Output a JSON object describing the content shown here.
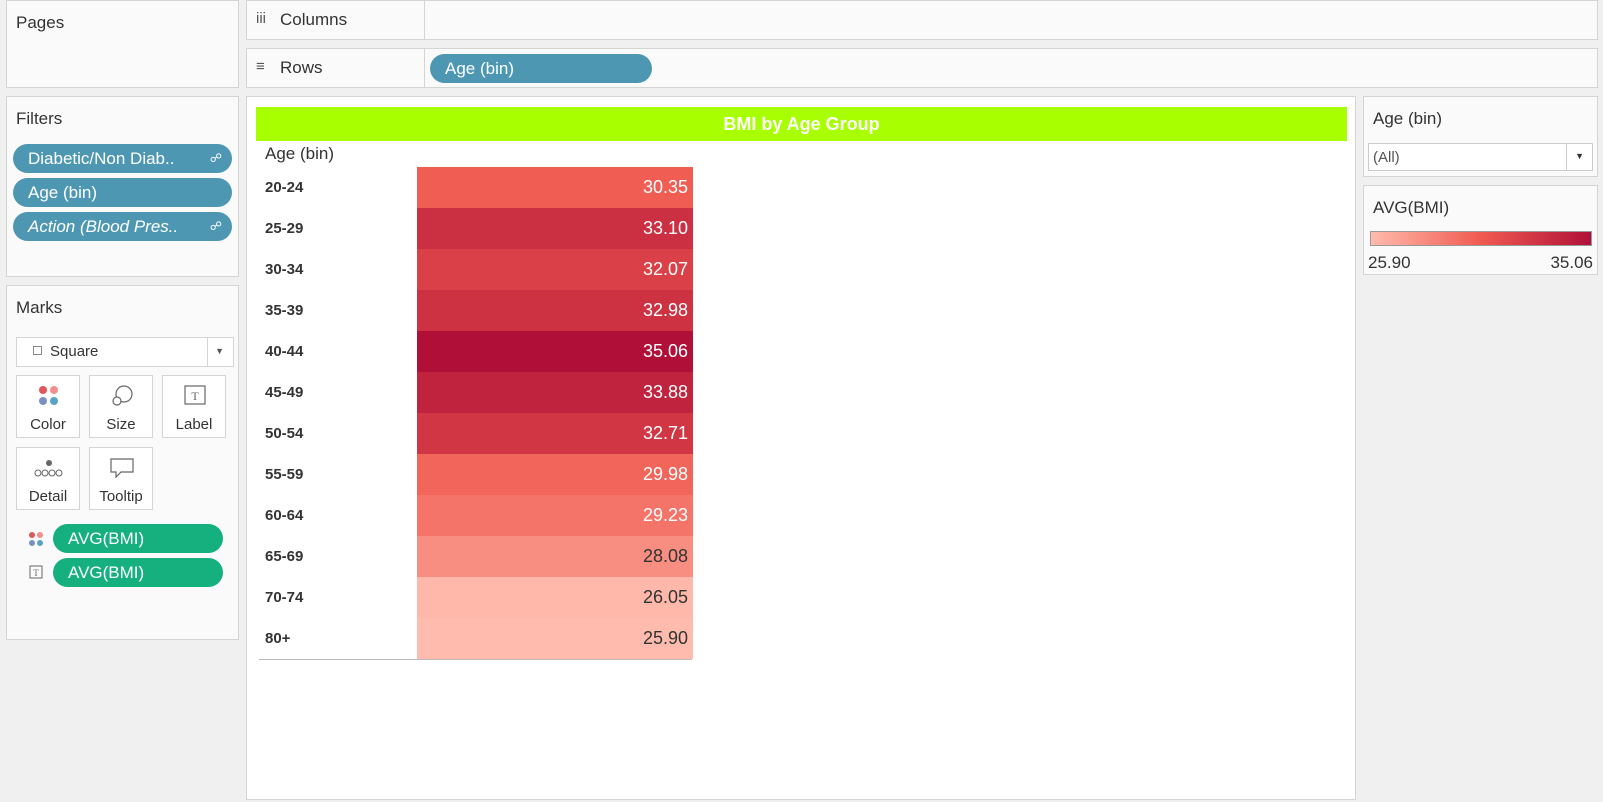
{
  "pages": {
    "title": "Pages"
  },
  "columns_shelf": {
    "label": "Columns",
    "icon": "columns-icon"
  },
  "rows_shelf": {
    "label": "Rows",
    "icon": "rows-icon",
    "pill": "Age (bin)"
  },
  "filters": {
    "title": "Filters",
    "pills": [
      {
        "label": "Diabetic/Non Diab..",
        "linked": true,
        "italic": false
      },
      {
        "label": "Age (bin)",
        "linked": false,
        "italic": false
      },
      {
        "label": "Action (Blood Pres..",
        "linked": true,
        "italic": true
      }
    ]
  },
  "marks": {
    "title": "Marks",
    "mark_type": "Square",
    "buttons": [
      "Color",
      "Size",
      "Label",
      "Detail",
      "Tooltip"
    ],
    "fields": [
      {
        "label": "AVG(BMI)",
        "icon": "color-dots-icon"
      },
      {
        "label": "AVG(BMI)",
        "icon": "label-icon"
      }
    ]
  },
  "view": {
    "title": "BMI by Age Group",
    "row_header": "Age (bin)"
  },
  "chart_data": {
    "type": "table",
    "title": "BMI by Age Group",
    "row_field": "Age (bin)",
    "measure": "AVG(BMI)",
    "categories": [
      "20-24",
      "25-29",
      "30-34",
      "35-39",
      "40-44",
      "45-49",
      "50-54",
      "55-59",
      "60-64",
      "65-69",
      "70-74",
      "80+"
    ],
    "values": [
      30.35,
      33.1,
      32.07,
      32.98,
      35.06,
      33.88,
      32.71,
      29.98,
      29.23,
      28.08,
      26.05,
      25.9
    ],
    "labels": [
      "30.35",
      "33.10",
      "32.07",
      "32.98",
      "35.06",
      "33.88",
      "32.71",
      "29.98",
      "29.23",
      "28.08",
      "26.05",
      "25.90"
    ],
    "color_scale": {
      "min": 25.9,
      "max": 35.06,
      "min_color": "#ffbbad",
      "max_color": "#b01038"
    }
  },
  "age_filter": {
    "title": "Age (bin)",
    "value": "(All)"
  },
  "color_legend": {
    "title": "AVG(BMI)",
    "min_label": "25.90",
    "max_label": "35.06"
  },
  "colors": {
    "pill_blue": "#4d97b3",
    "pill_green": "#16b07f",
    "title_bar": "#a8ff00"
  }
}
